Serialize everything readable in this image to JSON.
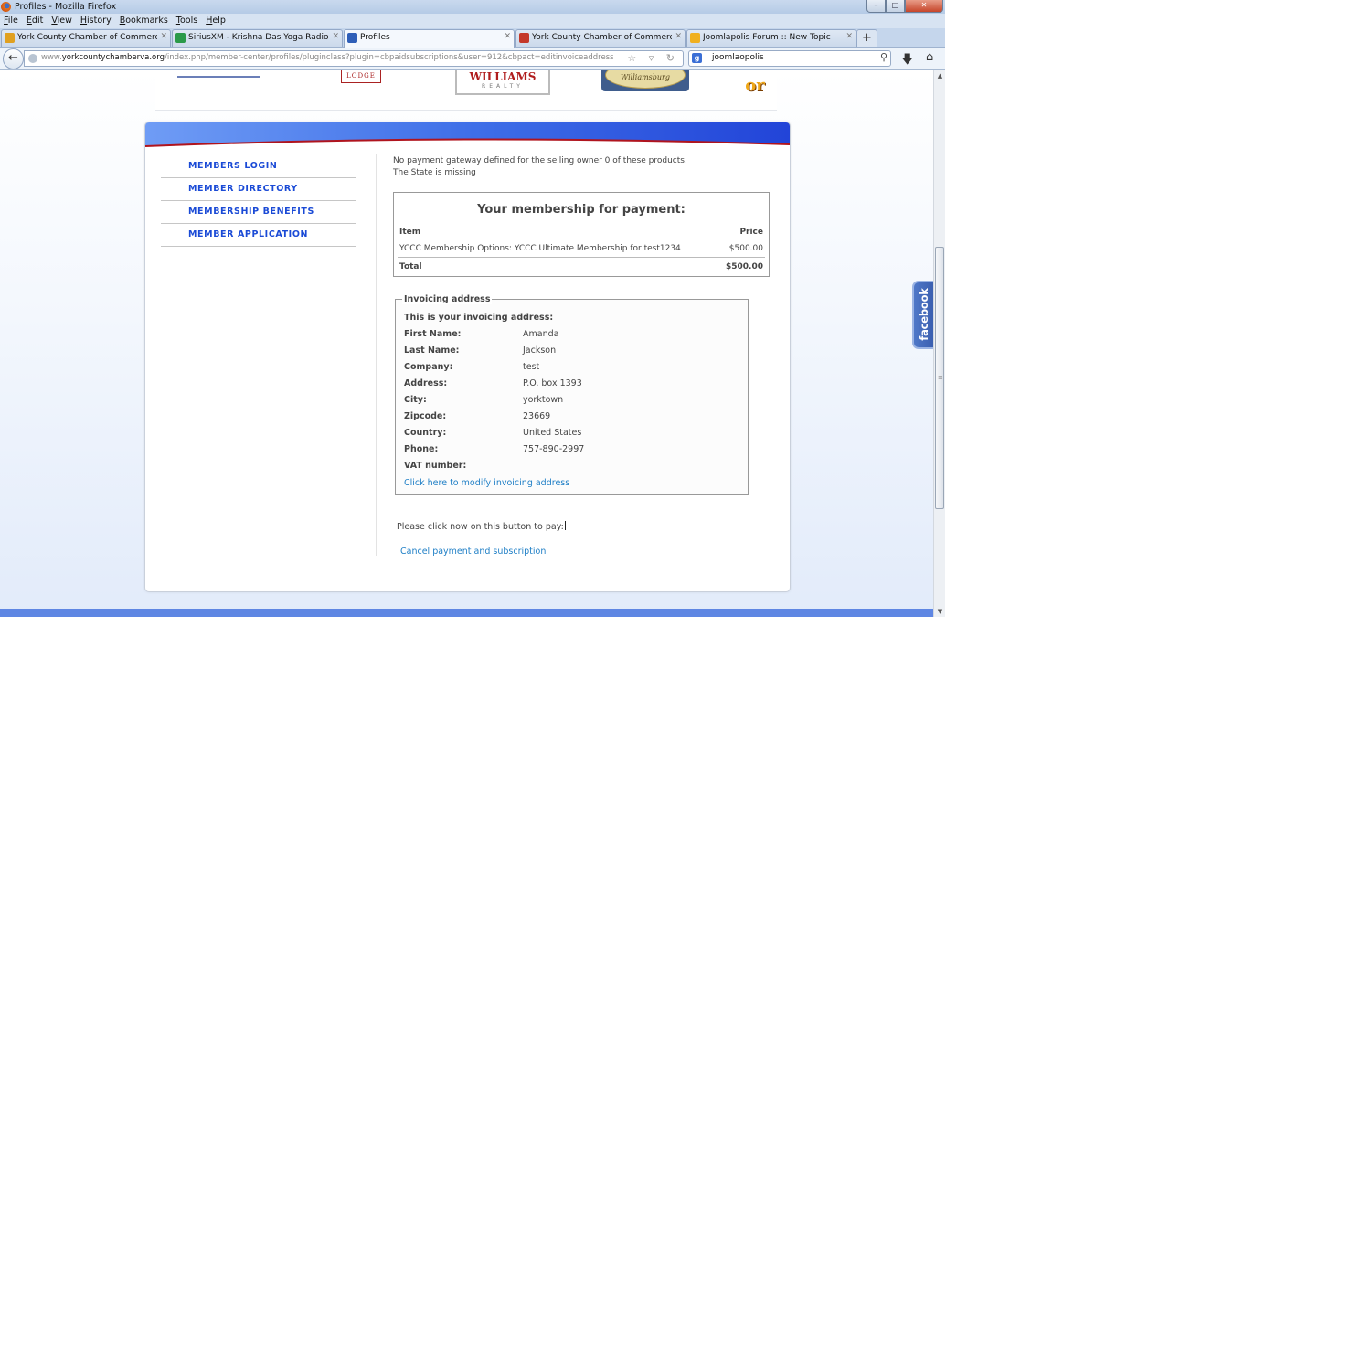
{
  "window": {
    "title": "Profiles - Mozilla Firefox",
    "controls": {
      "minimize": "–",
      "maximize": "□",
      "close": "✕"
    }
  },
  "menu": [
    "File",
    "Edit",
    "View",
    "History",
    "Bookmarks",
    "Tools",
    "Help"
  ],
  "tabs": [
    {
      "label": "York County Chamber of Commerce ...",
      "favicon_color": "#e0a020",
      "active": false
    },
    {
      "label": "SiriusXM - Krishna Das Yoga Radio",
      "favicon_color": "#2a9a4a",
      "active": false
    },
    {
      "label": "Profiles",
      "favicon_color": "#2f5fb8",
      "active": true
    },
    {
      "label": "York County Chamber of Commerce ...",
      "favicon_color": "#c4382a",
      "active": false
    },
    {
      "label": "Joomlapolis Forum :: New Topic",
      "favicon_color": "#f0b020",
      "active": false
    }
  ],
  "toolbar": {
    "back_icon": "arrow-left-icon",
    "url_prefix": "www.",
    "url_domain": "yorkcountychamberva.org",
    "url_path": "/index.php/member-center/profiles/pluginclass?plugin=cbpaidsubscriptions&user=912&cbpact=editinvoiceaddress",
    "url_icons": "☆ ▿ ↻",
    "search_value": "joomlaopolis",
    "search_engine": "g"
  },
  "logos": {
    "lodge": "LODGE",
    "williams": "WILLIAMS",
    "williams_sub": "REALTY",
    "williamsburg": "Williamsburg",
    "or_text": "or"
  },
  "sidebar": {
    "items": [
      "MEMBERS LOGIN",
      "MEMBER DIRECTORY",
      "MEMBERSHIP BENEFITS",
      "MEMBER APPLICATION"
    ]
  },
  "messages": {
    "line1": "No payment gateway defined for the selling owner 0 of these products.",
    "line2": "The State is missing"
  },
  "payment": {
    "title": "Your membership for payment:",
    "headers": {
      "item": "Item",
      "price": "Price"
    },
    "items": [
      {
        "name": "YCCC Membership Options: YCCC Ultimate Membership for test1234",
        "price": "$500.00"
      }
    ],
    "total_label": "Total",
    "total": "$500.00"
  },
  "invoice": {
    "legend": "Invoicing address",
    "intro": "This is your invoicing address:",
    "fields": [
      {
        "label": "First Name:",
        "value": "Amanda"
      },
      {
        "label": "Last Name:",
        "value": "Jackson"
      },
      {
        "label": "Company:",
        "value": "test"
      },
      {
        "label": "Address:",
        "value": "P.O. box 1393"
      },
      {
        "label": "City:",
        "value": "yorktown"
      },
      {
        "label": "Zipcode:",
        "value": "23669"
      },
      {
        "label": "Country:",
        "value": "United States"
      },
      {
        "label": "Phone:",
        "value": "757-890-2997"
      },
      {
        "label": "VAT number:",
        "value": ""
      }
    ],
    "modify_link": "Click here to modify invoicing address"
  },
  "pay_note": "Please click now on this button to pay:",
  "cancel_link": "Cancel payment and subscription",
  "facebook": "facebook",
  "colors": {
    "nav_link": "#1a4ad6",
    "link": "#1f7fc6",
    "header_blue": "#3f6fe8",
    "header_red": "#b0141e",
    "footer": "#5e86e3"
  }
}
